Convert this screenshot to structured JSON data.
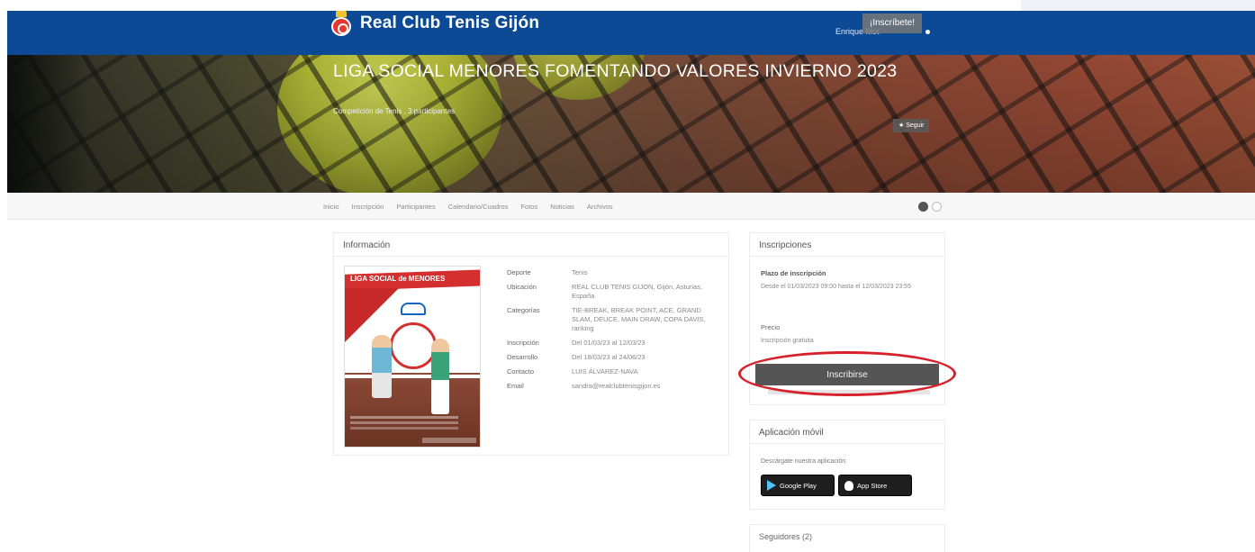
{
  "header": {
    "club_name": "Real Club Tenis Gijón",
    "user_name": "Enrique Mot"
  },
  "hero": {
    "register_button": "¡Inscríbete!",
    "title": "LIGA SOCIAL MENORES FOMENTANDO VALORES INVIERNO 2023",
    "subtitle": "Competición de Tenis , 3 participantes",
    "follow_button": "Seguir"
  },
  "tabs": [
    {
      "label": "Inicio"
    },
    {
      "label": "Inscripción"
    },
    {
      "label": "Participantes"
    },
    {
      "label": "Calendario/Cuadros"
    },
    {
      "label": "Fotos"
    },
    {
      "label": "Noticias"
    },
    {
      "label": "Archivos"
    }
  ],
  "info": {
    "heading": "Información",
    "poster_title": "LIGA SOCIAL de MENORES",
    "rows": [
      {
        "label": "Deporte",
        "value": "Tenis"
      },
      {
        "label": "Ubicación",
        "value": "REAL CLUB TENIS GIJON, Gijón, Asturias, España"
      },
      {
        "label": "Categorías",
        "value": "TIE-BREAK, BREAK POINT, ACE, GRAND SLAM, DEUCE, MAIN DRAW, COPA DAVIS, ranking"
      },
      {
        "label": "Inscripción",
        "value": "Del 01/03/23 al 12/03/23"
      },
      {
        "label": "Desarrollo",
        "value": "Del 18/03/23 al 24/06/23"
      },
      {
        "label": "Contacto",
        "value": "LUIS ÁLVAREZ-NAVA"
      },
      {
        "label": "Email",
        "value": "sandra@realclubtenisgijon.es"
      }
    ]
  },
  "inscripciones": {
    "heading": "Inscripciones",
    "plazo_label": "Plazo de inscripción",
    "plazo_value": "Desde el 01/03/2023 09:00 hasta el 12/03/2023 23:55",
    "precio_label": "Precio",
    "precio_value": "Inscripción gratuita",
    "button": "Inscribirse"
  },
  "app": {
    "heading": "Aplicación móvil",
    "description": "Descárgate nuestra aplicación",
    "google_play": "Google Play",
    "app_store": "App Store"
  },
  "seguidores": {
    "heading": "Seguidores (2)"
  },
  "colors": {
    "brand_blue": "#0d4a96",
    "highlight_red": "#d6202a",
    "button_gray": "#555555"
  }
}
